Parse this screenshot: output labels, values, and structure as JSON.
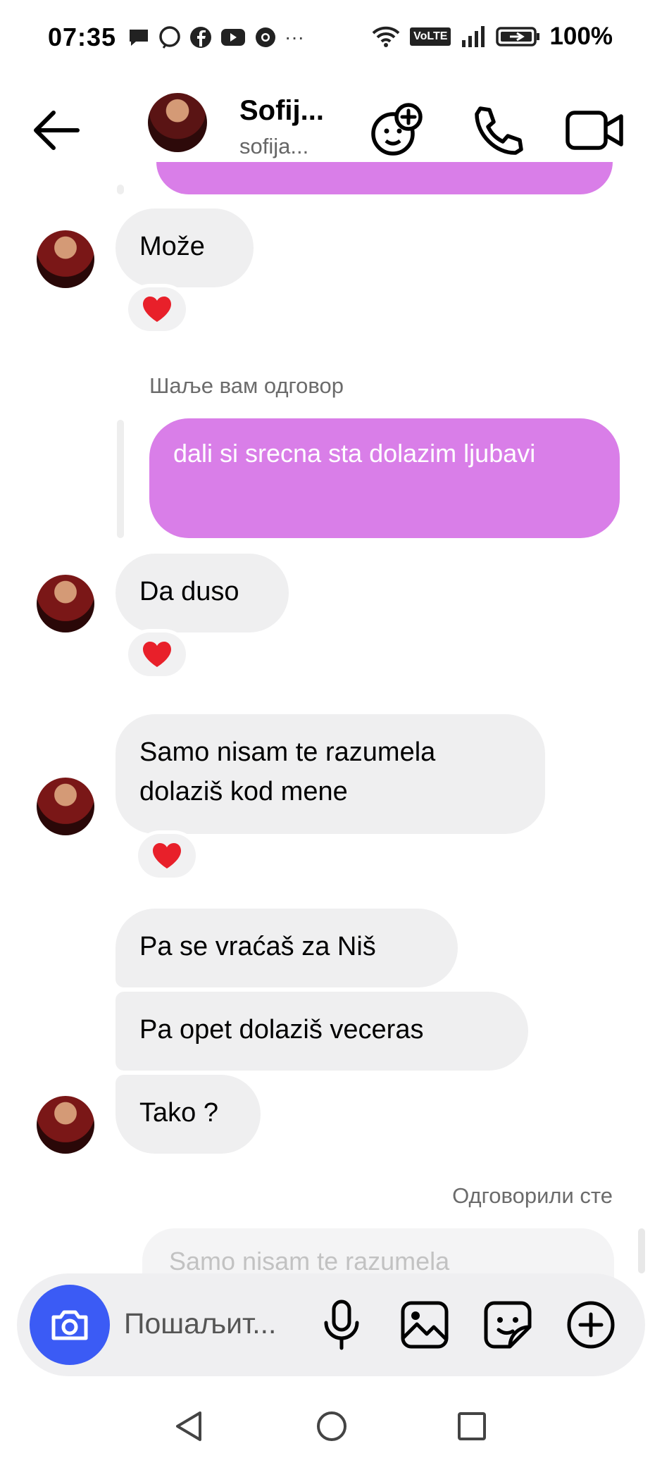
{
  "status_bar": {
    "time": "07:35",
    "network": "VoLTE",
    "battery": "100%"
  },
  "header": {
    "name": "Sofij...",
    "username": "sofija..."
  },
  "messages": {
    "m1": "Može",
    "reply_meta": "Шаље вам одговор",
    "out1": "dali si srecna sta dolazim ljubavi",
    "m2": "Da duso",
    "m3": "Samo nisam te razumela dolaziš kod mene",
    "m4": "Pa se vraćaš za Niš",
    "m5": "Pa opet dolaziš veceras",
    "m6": "Tako ?",
    "replied_meta": "Одговорили сте",
    "quoted_preview": "Samo nisam te razumela"
  },
  "composer": {
    "placeholder": "Пошаљит..."
  },
  "colors": {
    "outgoing_bubble": "#d97ee8",
    "incoming_bubble": "#efeff0",
    "camera_button": "#3b5bf5"
  },
  "icons": [
    "back-arrow-icon",
    "add-people-icon",
    "phone-icon",
    "video-camera-icon",
    "heart-icon",
    "camera-icon",
    "microphone-icon",
    "gallery-icon",
    "sticker-icon",
    "plus-icon",
    "nav-back-icon",
    "nav-home-icon",
    "nav-recents-icon"
  ]
}
